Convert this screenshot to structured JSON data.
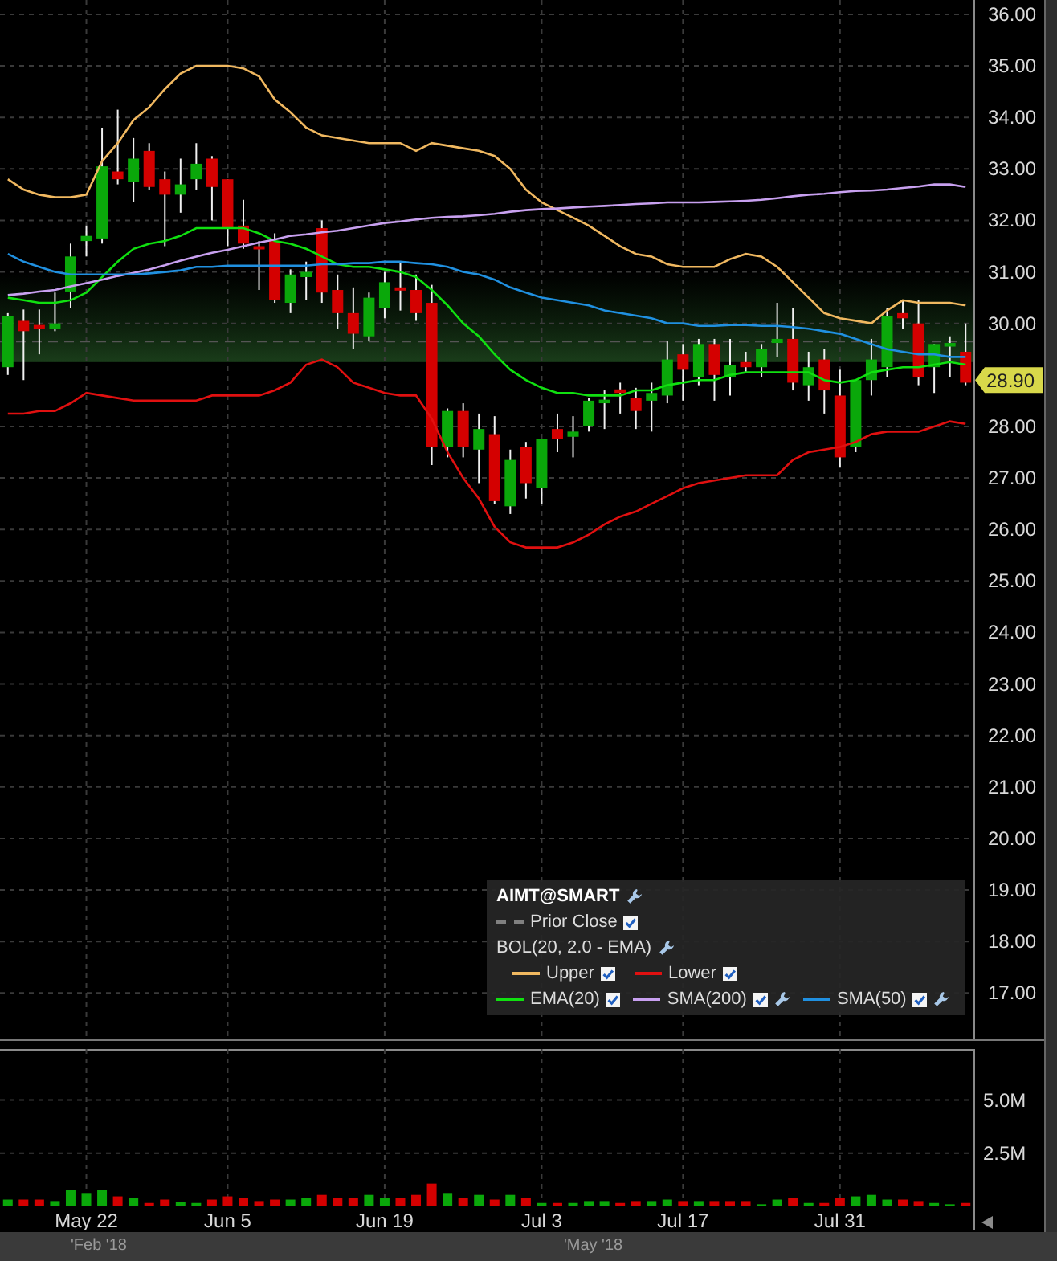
{
  "price_chart": {
    "chart_data": {
      "type": "candlestick",
      "grid": true,
      "ylim": [
        16.1,
        36.28
      ],
      "yticks": [
        {
          "value": 36,
          "label": "36.00"
        },
        {
          "value": 35,
          "label": "35.00"
        },
        {
          "value": 34,
          "label": "34.00"
        },
        {
          "value": 33,
          "label": "33.00"
        },
        {
          "value": 32,
          "label": "32.00"
        },
        {
          "value": 31,
          "label": "31.00"
        },
        {
          "value": 30,
          "label": "30.00"
        },
        {
          "value": 28,
          "label": "28.00"
        },
        {
          "value": 27,
          "label": "27.00"
        },
        {
          "value": 26,
          "label": "26.00"
        },
        {
          "value": 25,
          "label": "25.00"
        },
        {
          "value": 24,
          "label": "24.00"
        },
        {
          "value": 23,
          "label": "23.00"
        },
        {
          "value": 22,
          "label": "22.00"
        },
        {
          "value": 21,
          "label": "21.00"
        },
        {
          "value": 20,
          "label": "20.00"
        },
        {
          "value": 19,
          "label": "19.00"
        },
        {
          "value": 18,
          "label": "18.00"
        },
        {
          "value": 17,
          "label": "17.00"
        }
      ],
      "ohlc": [
        [
          29.15,
          30.2,
          29.0,
          30.15
        ],
        [
          30.05,
          30.27,
          28.9,
          29.85
        ],
        [
          29.97,
          30.27,
          29.4,
          29.9
        ],
        [
          29.9,
          30.6,
          29.85,
          30.0
        ],
        [
          30.62,
          31.55,
          30.3,
          31.3
        ],
        [
          31.6,
          31.9,
          31.3,
          31.7
        ],
        [
          31.65,
          33.8,
          31.55,
          33.05
        ],
        [
          32.95,
          34.15,
          32.7,
          32.8
        ],
        [
          32.75,
          33.6,
          32.35,
          33.2
        ],
        [
          33.35,
          33.5,
          32.6,
          32.65
        ],
        [
          32.8,
          32.95,
          31.5,
          32.5
        ],
        [
          32.5,
          33.2,
          32.15,
          32.7
        ],
        [
          32.8,
          33.5,
          32.6,
          33.1
        ],
        [
          33.2,
          33.25,
          32.0,
          32.65
        ],
        [
          32.8,
          32.8,
          31.5,
          31.85
        ],
        [
          31.9,
          32.4,
          31.45,
          31.55
        ],
        [
          31.5,
          31.6,
          30.65,
          31.45
        ],
        [
          31.6,
          31.75,
          30.4,
          30.45
        ],
        [
          30.4,
          31.05,
          30.2,
          30.95
        ],
        [
          30.9,
          31.2,
          30.45,
          31.0
        ],
        [
          31.85,
          32.0,
          30.4,
          30.6
        ],
        [
          30.65,
          30.95,
          29.9,
          30.2
        ],
        [
          30.2,
          30.7,
          29.5,
          29.8
        ],
        [
          29.75,
          30.6,
          29.65,
          30.5
        ],
        [
          30.3,
          31.0,
          30.1,
          30.8
        ],
        [
          30.7,
          31.2,
          30.25,
          30.65
        ],
        [
          30.65,
          30.95,
          30.05,
          30.2
        ],
        [
          30.4,
          30.75,
          27.25,
          27.6
        ],
        [
          27.6,
          28.35,
          27.4,
          28.3
        ],
        [
          28.3,
          28.45,
          27.4,
          27.6
        ],
        [
          27.55,
          28.25,
          26.9,
          27.95
        ],
        [
          27.85,
          28.2,
          26.5,
          26.55
        ],
        [
          26.45,
          27.55,
          26.3,
          27.35
        ],
        [
          27.6,
          27.7,
          26.6,
          26.9
        ],
        [
          26.8,
          27.75,
          26.5,
          27.75
        ],
        [
          27.95,
          28.25,
          27.5,
          27.75
        ],
        [
          27.8,
          28.2,
          27.4,
          27.9
        ],
        [
          28.0,
          28.55,
          27.9,
          28.5
        ],
        [
          28.45,
          28.7,
          27.95,
          28.52
        ],
        [
          28.72,
          28.85,
          28.25,
          28.65
        ],
        [
          28.55,
          28.75,
          27.95,
          28.3
        ],
        [
          28.5,
          28.85,
          27.9,
          28.65
        ],
        [
          28.6,
          29.65,
          28.45,
          29.3
        ],
        [
          29.4,
          29.6,
          28.5,
          29.1
        ],
        [
          28.95,
          29.7,
          28.8,
          29.6
        ],
        [
          29.6,
          29.7,
          28.5,
          29.0
        ],
        [
          28.95,
          29.7,
          28.6,
          29.2
        ],
        [
          29.25,
          29.45,
          29.05,
          29.15
        ],
        [
          29.15,
          29.6,
          28.95,
          29.5
        ],
        [
          29.62,
          30.4,
          29.35,
          29.7
        ],
        [
          29.7,
          30.3,
          28.7,
          28.85
        ],
        [
          28.8,
          29.45,
          28.5,
          29.15
        ],
        [
          29.3,
          29.5,
          28.25,
          28.7
        ],
        [
          28.6,
          29.1,
          27.2,
          27.4
        ],
        [
          27.6,
          28.9,
          27.5,
          28.9
        ],
        [
          28.9,
          29.7,
          28.6,
          29.3
        ],
        [
          29.15,
          30.3,
          28.95,
          30.15
        ],
        [
          30.2,
          30.45,
          29.9,
          30.1
        ],
        [
          30.0,
          30.45,
          28.8,
          28.95
        ],
        [
          29.15,
          29.6,
          28.65,
          29.6
        ],
        [
          29.55,
          29.75,
          28.95,
          29.62
        ],
        [
          29.45,
          30.0,
          28.8,
          28.85
        ]
      ],
      "series": [
        {
          "type": "line",
          "color": "#f0b860",
          "values": [
            32.8,
            32.6,
            32.5,
            32.45,
            32.45,
            32.5,
            33.15,
            33.5,
            33.95,
            34.2,
            34.55,
            34.85,
            35.0,
            35.0,
            35.0,
            34.95,
            34.8,
            34.35,
            34.1,
            33.8,
            33.65,
            33.6,
            33.55,
            33.5,
            33.5,
            33.5,
            33.35,
            33.5,
            33.45,
            33.4,
            33.35,
            33.25,
            33.0,
            32.6,
            32.35,
            32.2,
            32.05,
            31.9,
            31.7,
            31.5,
            31.35,
            31.3,
            31.15,
            31.1,
            31.1,
            31.1,
            31.25,
            31.35,
            31.3,
            31.1,
            30.8,
            30.5,
            30.2,
            30.1,
            30.05,
            30.0,
            30.25,
            30.45,
            30.4,
            30.4,
            30.4,
            30.35
          ]
        },
        {
          "type": "line",
          "color": "#e01010",
          "values": [
            28.25,
            28.25,
            28.3,
            28.3,
            28.45,
            28.65,
            28.6,
            28.55,
            28.5,
            28.5,
            28.5,
            28.5,
            28.5,
            28.6,
            28.6,
            28.6,
            28.6,
            28.7,
            28.85,
            29.2,
            29.3,
            29.15,
            28.85,
            28.75,
            28.65,
            28.6,
            28.6,
            28.15,
            27.5,
            27.0,
            26.6,
            26.05,
            25.75,
            25.65,
            25.65,
            25.65,
            25.75,
            25.9,
            26.1,
            26.25,
            26.35,
            26.5,
            26.65,
            26.8,
            26.9,
            26.95,
            27.0,
            27.05,
            27.05,
            27.05,
            27.35,
            27.5,
            27.55,
            27.6,
            27.7,
            27.85,
            27.9,
            27.9,
            27.9,
            28.0,
            28.1,
            28.05
          ]
        },
        {
          "type": "line",
          "color": "#10e010",
          "values": [
            30.5,
            30.45,
            30.4,
            30.4,
            30.45,
            30.6,
            30.9,
            31.2,
            31.45,
            31.55,
            31.6,
            31.7,
            31.85,
            31.85,
            31.85,
            31.85,
            31.75,
            31.6,
            31.55,
            31.45,
            31.3,
            31.15,
            31.1,
            31.1,
            31.05,
            31.0,
            30.9,
            30.65,
            30.35,
            30.0,
            29.75,
            29.4,
            29.1,
            28.9,
            28.75,
            28.65,
            28.65,
            28.6,
            28.6,
            28.6,
            28.7,
            28.7,
            28.8,
            28.85,
            28.9,
            28.9,
            29.0,
            29.05,
            29.05,
            29.05,
            29.05,
            29.05,
            28.9,
            28.85,
            28.9,
            29.05,
            29.1,
            29.15,
            29.15,
            29.2,
            29.25,
            29.2
          ]
        },
        {
          "type": "line",
          "color": "#c8a0f0",
          "values": [
            30.55,
            30.58,
            30.62,
            30.65,
            30.72,
            30.78,
            30.85,
            30.92,
            30.98,
            31.05,
            31.13,
            31.22,
            31.3,
            31.37,
            31.43,
            31.5,
            31.57,
            31.63,
            31.7,
            31.73,
            31.77,
            31.8,
            31.85,
            31.9,
            31.95,
            31.98,
            32.02,
            32.05,
            32.07,
            32.08,
            32.1,
            32.13,
            32.17,
            32.2,
            32.22,
            32.23,
            32.25,
            32.27,
            32.28,
            32.3,
            32.32,
            32.33,
            32.35,
            32.35,
            32.35,
            32.36,
            32.37,
            32.38,
            32.4,
            32.43,
            32.47,
            32.5,
            32.52,
            32.55,
            32.57,
            32.58,
            32.6,
            32.63,
            32.66,
            32.7,
            32.7,
            32.65
          ]
        },
        {
          "type": "line",
          "color": "#2090e0",
          "values": [
            31.35,
            31.2,
            31.1,
            31.0,
            30.95,
            30.95,
            30.95,
            30.95,
            30.95,
            30.97,
            31.0,
            31.03,
            31.1,
            31.1,
            31.12,
            31.12,
            31.12,
            31.12,
            31.12,
            31.12,
            31.15,
            31.15,
            31.17,
            31.17,
            31.2,
            31.2,
            31.17,
            31.15,
            31.1,
            31.0,
            30.95,
            30.85,
            30.7,
            30.6,
            30.5,
            30.45,
            30.4,
            30.35,
            30.25,
            30.2,
            30.15,
            30.1,
            30.0,
            30.0,
            29.95,
            29.95,
            29.97,
            29.97,
            29.95,
            29.95,
            29.93,
            29.9,
            29.85,
            29.8,
            29.7,
            29.6,
            29.5,
            29.45,
            29.4,
            29.4,
            29.35,
            29.35
          ]
        }
      ],
      "bands": [
        {
          "axis": "y",
          "from": 29.25,
          "to": 31.0
        }
      ],
      "ref_lines": [
        {
          "axis": "y",
          "value": 29.65
        }
      ],
      "annotations": [
        {
          "y": 28.9,
          "text": "28.90"
        }
      ]
    }
  },
  "legend": {
    "title": "AIMT@SMART",
    "settings": true,
    "rows": [
      {
        "kind": "entries",
        "entries": [
          {
            "label": "Prior Close",
            "color": "#808080",
            "dashed": true,
            "checked": true,
            "settings": false
          }
        ]
      },
      {
        "kind": "group",
        "label": "BOL(20, 2.0 - EMA)",
        "settings": true,
        "children": [
          {
            "label": "Upper",
            "color": "#f0b860",
            "checked": true,
            "settings": false
          },
          {
            "label": "Lower",
            "color": "#e01010",
            "checked": true,
            "settings": false
          }
        ]
      },
      {
        "kind": "entries",
        "entries": [
          {
            "label": "EMA(20)",
            "color": "#10e010",
            "checked": true,
            "settings": false
          },
          {
            "label": "SMA(200)",
            "color": "#c8a0f0",
            "checked": true,
            "settings": true
          },
          {
            "label": "SMA(50)",
            "color": "#2090e0",
            "checked": true,
            "settings": true
          }
        ]
      }
    ]
  },
  "volume_chart": {
    "chart_data": {
      "type": "bar",
      "stacked": true,
      "grid": true,
      "ylim": [
        0,
        7.4
      ],
      "categories": [
        null,
        null,
        null,
        null,
        null,
        "May 22",
        null,
        null,
        null,
        null,
        null,
        null,
        null,
        null,
        "Jun 5",
        null,
        null,
        null,
        null,
        null,
        null,
        null,
        null,
        null,
        "Jun 19",
        null,
        null,
        null,
        null,
        null,
        null,
        null,
        null,
        null,
        "Jul 3",
        null,
        null,
        null,
        null,
        null,
        null,
        null,
        null,
        "Jul 17",
        null,
        null,
        null,
        null,
        null,
        null,
        null,
        null,
        null,
        "Jul 31",
        null,
        null,
        null,
        null,
        null,
        null,
        null,
        null
      ],
      "yticks": [
        {
          "value": 2.5,
          "label": "2.5M"
        },
        {
          "value": 5,
          "label": "5.0M"
        }
      ],
      "series": [
        {
          "color": "#0aa80a",
          "values": [
            0.32,
            null,
            null,
            0.25,
            0.76,
            0.63,
            0.76,
            null,
            0.38,
            null,
            null,
            0.22,
            0.16,
            null,
            null,
            null,
            null,
            null,
            0.32,
            0.41,
            null,
            null,
            null,
            0.54,
            0.41,
            null,
            null,
            null,
            0.63,
            null,
            0.54,
            null,
            0.54,
            null,
            0.16,
            null,
            0.16,
            0.25,
            0.25,
            null,
            null,
            0.25,
            0.32,
            null,
            0.25,
            null,
            null,
            null,
            0.1,
            0.32,
            null,
            0.16,
            null,
            null,
            0.47,
            0.54,
            0.32,
            null,
            null,
            0.16,
            0.1,
            null
          ]
        },
        {
          "color": "#d40000",
          "values": [
            null,
            0.32,
            0.32,
            null,
            null,
            null,
            null,
            0.47,
            null,
            0.16,
            0.32,
            null,
            null,
            0.32,
            0.47,
            0.41,
            0.25,
            0.32,
            null,
            null,
            0.54,
            0.41,
            0.41,
            null,
            null,
            0.41,
            0.54,
            1.07,
            null,
            0.41,
            null,
            0.32,
            null,
            0.41,
            null,
            0.16,
            null,
            null,
            null,
            0.16,
            0.25,
            null,
            null,
            0.25,
            null,
            0.25,
            0.25,
            0.25,
            null,
            null,
            0.41,
            null,
            0.16,
            0.41,
            null,
            null,
            null,
            0.32,
            0.25,
            null,
            null,
            0.16
          ]
        }
      ]
    }
  },
  "navigator": {
    "labels": [
      "'Feb '18",
      "'May '18"
    ]
  }
}
